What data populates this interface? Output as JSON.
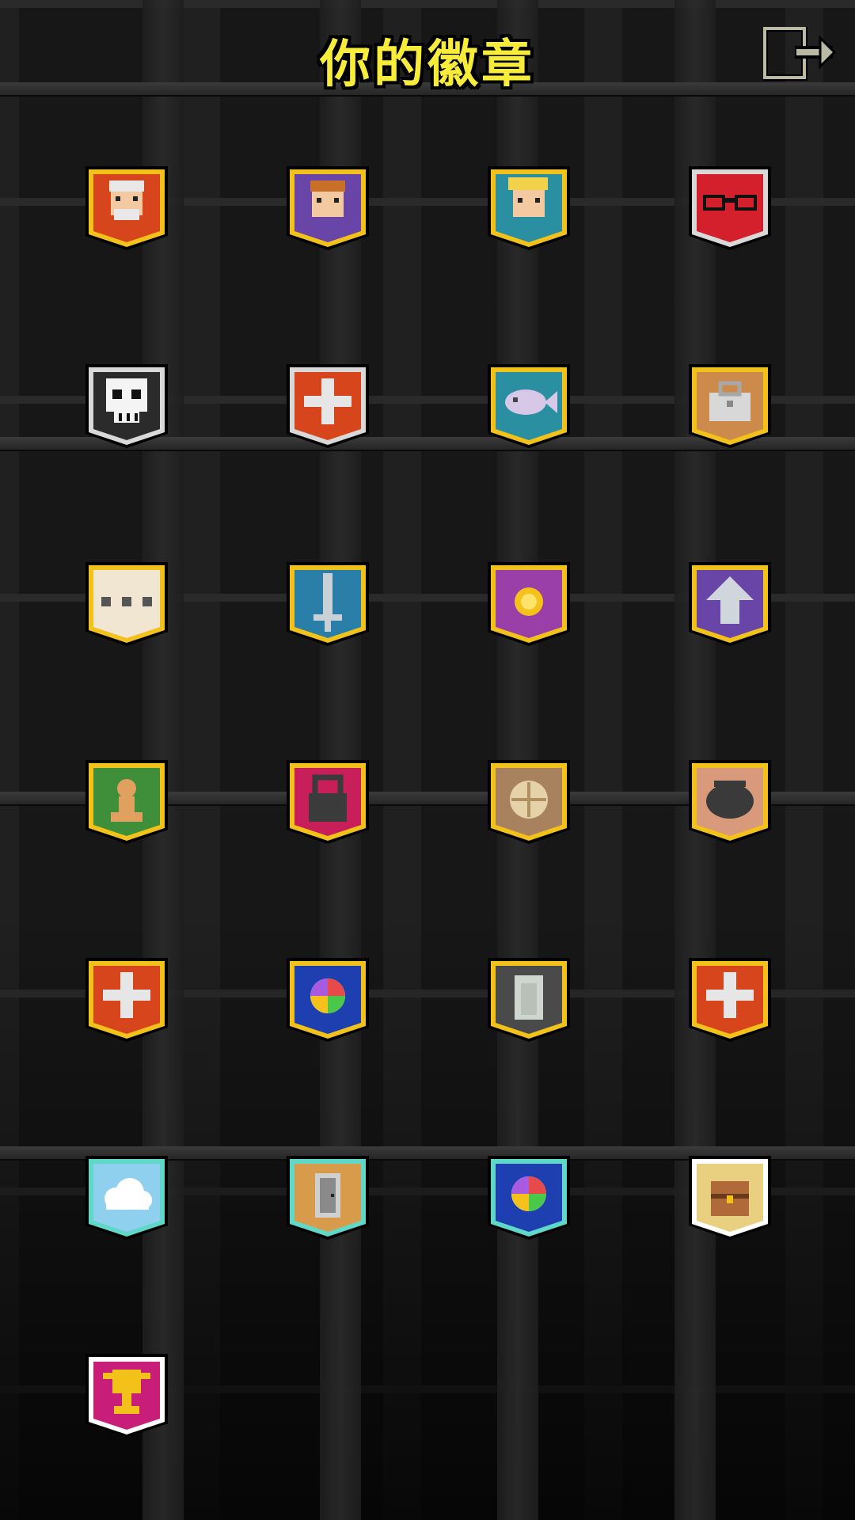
{
  "header": {
    "title": "你的徽章",
    "exit_icon": "exit-door-arrow-icon"
  },
  "badges": [
    {
      "icon": "hero-warrior-icon",
      "frame": "gold",
      "bg": "#d7451c"
    },
    {
      "icon": "hero-mage-icon",
      "frame": "gold",
      "bg": "#6a45a8"
    },
    {
      "icon": "hero-rogue-icon",
      "frame": "gold",
      "bg": "#2a8fa0"
    },
    {
      "icon": "glasses-icon",
      "frame": "silver",
      "bg": "#d41f2d"
    },
    {
      "icon": "skull-icon",
      "frame": "silver",
      "bg": "#2b2b2b"
    },
    {
      "icon": "plus-icon",
      "frame": "silver",
      "bg": "#d7451c"
    },
    {
      "icon": "fish-icon",
      "frame": "gold",
      "bg": "#2a8fa0"
    },
    {
      "icon": "bag-icon",
      "frame": "gold",
      "bg": "#cc8a4b"
    },
    {
      "icon": "scroll-icon",
      "frame": "gold",
      "bg": "#f0e6d2"
    },
    {
      "icon": "sword-icon",
      "frame": "gold",
      "bg": "#2a7fa8"
    },
    {
      "icon": "coin-icon",
      "frame": "gold",
      "bg": "#9b3fa8"
    },
    {
      "icon": "arrow-up-icon",
      "frame": "gold",
      "bg": "#6a45a8"
    },
    {
      "icon": "chess-pawn-icon",
      "frame": "gold",
      "bg": "#3f8f3a"
    },
    {
      "icon": "lock-icon",
      "frame": "gold",
      "bg": "#c81e5a"
    },
    {
      "icon": "bread-icon",
      "frame": "gold",
      "bg": "#a8825e"
    },
    {
      "icon": "pot-icon",
      "frame": "gold",
      "bg": "#d89a7a"
    },
    {
      "icon": "plus-icon",
      "frame": "gold",
      "bg": "#d7451c"
    },
    {
      "icon": "rainbow-orb-icon",
      "frame": "gold",
      "bg": "#1e3fb0"
    },
    {
      "icon": "tombstone-icon",
      "frame": "gold",
      "bg": "#4a4a4a"
    },
    {
      "icon": "plus-icon",
      "frame": "gold",
      "bg": "#d7451c"
    },
    {
      "icon": "cloud-icon",
      "frame": "teal",
      "bg": "#8fd0ee"
    },
    {
      "icon": "door-icon",
      "frame": "teal",
      "bg": "#d89a4b"
    },
    {
      "icon": "rainbow-orb-icon",
      "frame": "teal",
      "bg": "#1e3fb0"
    },
    {
      "icon": "chest-icon",
      "frame": "white",
      "bg": "#e8d080"
    },
    {
      "icon": "trophy-icon",
      "frame": "white",
      "bg": "#c81e7a"
    }
  ],
  "colors": {
    "gold_frame": "#f2c21b",
    "silver_frame": "#d9d9d9",
    "teal_frame": "#5fd8c8",
    "white_frame": "#ffffff",
    "title": "#f8ec3b"
  }
}
